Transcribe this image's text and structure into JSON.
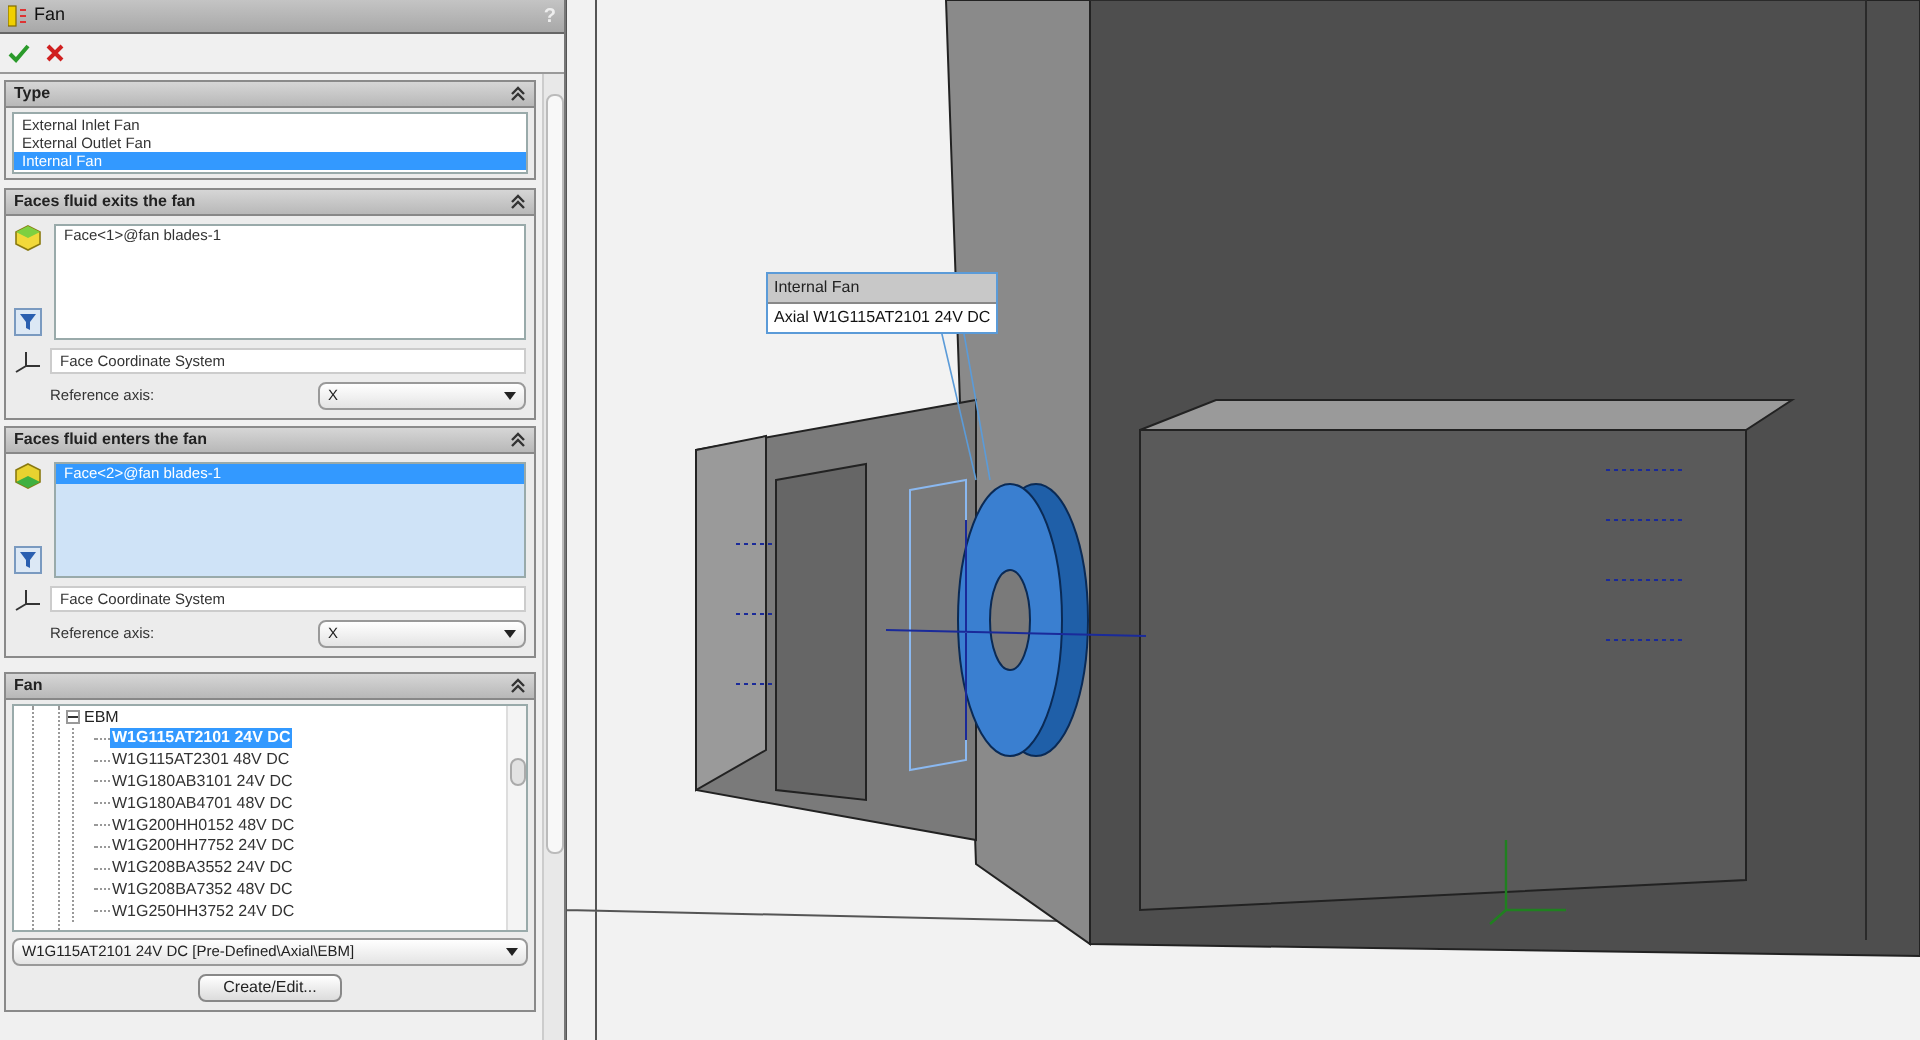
{
  "panel": {
    "title": "Fan",
    "help": "?"
  },
  "type_section": {
    "title": "Type",
    "options": [
      {
        "label": "External Inlet Fan",
        "selected": false
      },
      {
        "label": "External Outlet Fan",
        "selected": false
      },
      {
        "label": "Internal Fan",
        "selected": true
      }
    ]
  },
  "face_sections": [
    {
      "title": "Faces fluid exits the fan",
      "active": false,
      "faces": [
        {
          "label": "Face<1>@fan blades-1",
          "selected": false
        }
      ],
      "coordinate_system": "Face Coordinate System",
      "reference_axis_label": "Reference axis:",
      "reference_axis": "X"
    },
    {
      "title": "Faces fluid enters the fan",
      "active": true,
      "faces": [
        {
          "label": "Face<2>@fan blades-1",
          "selected": true
        }
      ],
      "coordinate_system": "Face Coordinate System",
      "reference_axis_label": "Reference axis:",
      "reference_axis": "X"
    }
  ],
  "fan_section": {
    "title": "Fan",
    "tree": [
      {
        "label": "EBM",
        "expanded": true,
        "children": [
          {
            "label": "W1G115AT2101 24V DC",
            "selected": true
          },
          {
            "label": "W1G115AT2301 48V DC",
            "selected": false
          },
          {
            "label": "W1G180AB3101 24V DC",
            "selected": false
          },
          {
            "label": "W1G180AB4701 48V DC",
            "selected": false
          },
          {
            "label": "W1G200HH0152 48V DC",
            "selected": false
          },
          {
            "label": "W1G200HH7752 24V DC",
            "selected": false
          },
          {
            "label": "W1G208BA3552 24V DC",
            "selected": false
          },
          {
            "label": "W1G208BA7352 48V DC",
            "selected": false
          },
          {
            "label": "W1G250HH3752 24V DC",
            "selected": false
          }
        ]
      }
    ],
    "selected_fan": "W1G115AT2101 24V DC [Pre-Defined\\Axial\\EBM]",
    "button": "Create/Edit..."
  },
  "callout": {
    "title": "Internal Fan",
    "text": "Axial W1G115AT2101 24V DC"
  }
}
